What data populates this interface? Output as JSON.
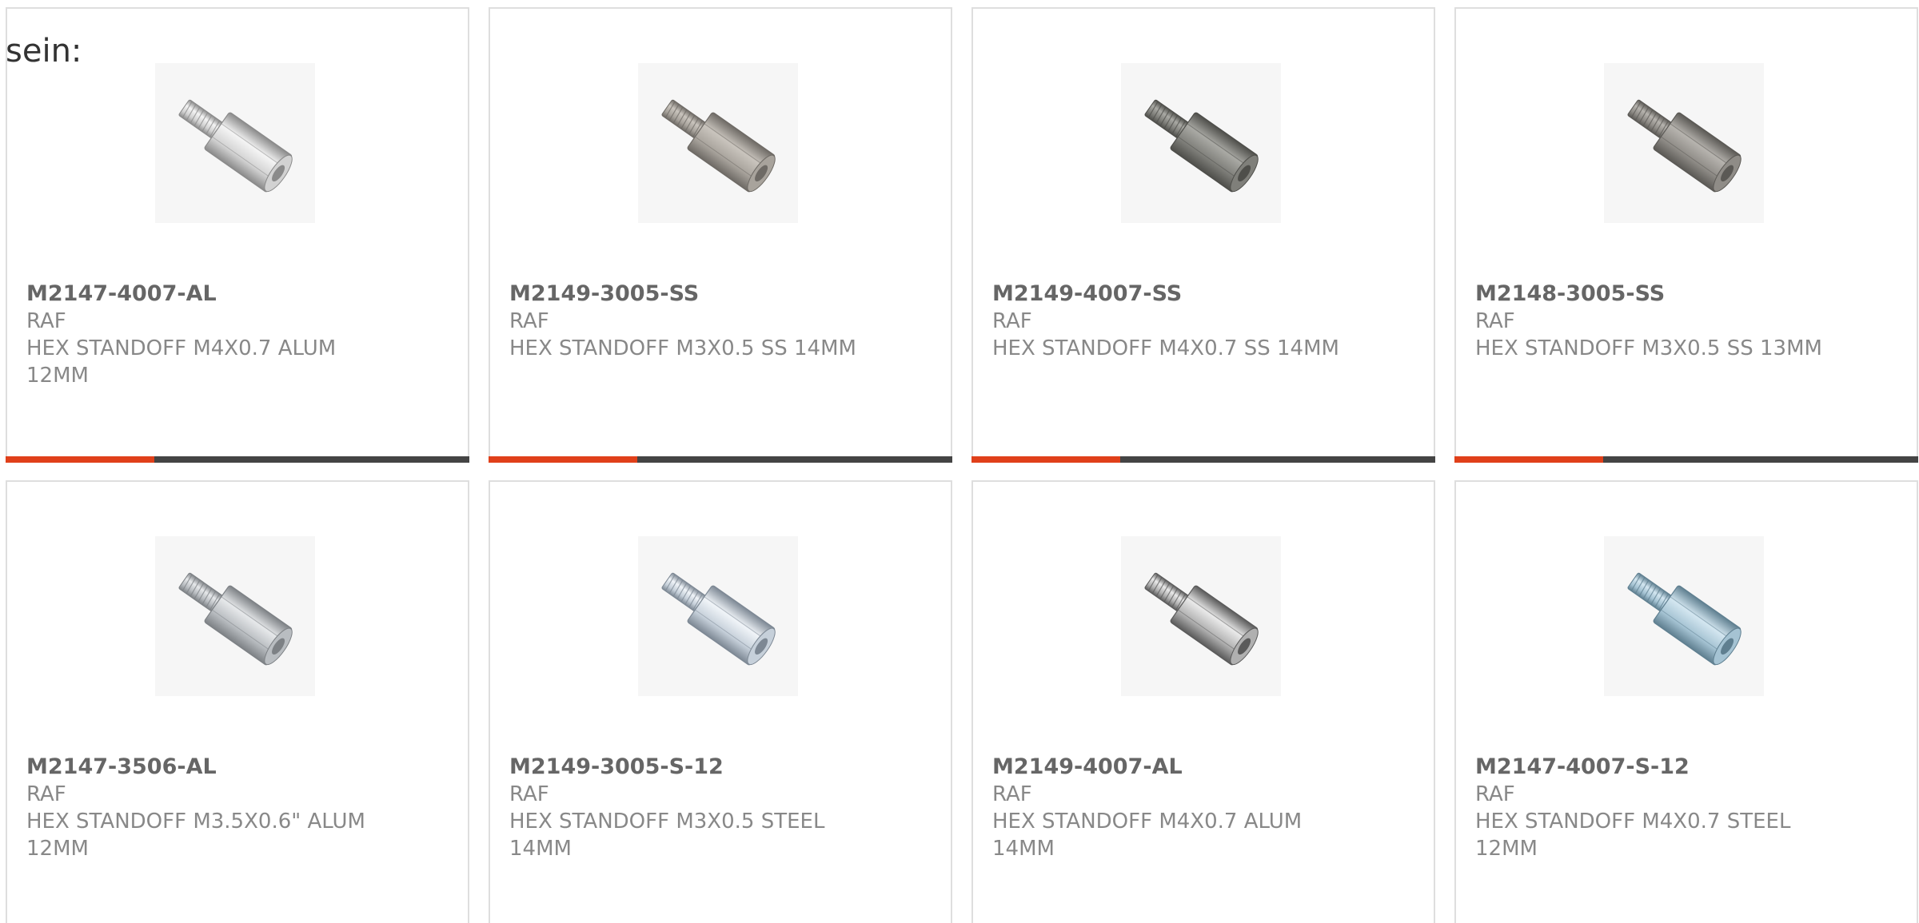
{
  "page": {
    "lead_text": "sein:",
    "accent_color": "#e0401a",
    "track_color": "#444444"
  },
  "products": [
    {
      "part_no": "M2147-4007-AL",
      "brand": "RAF",
      "desc_line1": "HEX STANDOFF M4X0.7 ALUM",
      "desc_line2": "12MM",
      "progress": 0.32,
      "image": "standoff-aluminum-icon",
      "tone": {
        "light": "#f4f4f4",
        "mid": "#d2d2d2",
        "dark": "#8a8a8a"
      }
    },
    {
      "part_no": "M2149-3005-SS",
      "brand": "RAF",
      "desc_line1": "HEX STANDOFF M3X0.5 SS 14MM",
      "desc_line2": "",
      "progress": 0.32,
      "image": "standoff-stainless-icon",
      "tone": {
        "light": "#c9c4bd",
        "mid": "#a8a39c",
        "dark": "#6e6a65"
      }
    },
    {
      "part_no": "M2149-4007-SS",
      "brand": "RAF",
      "desc_line1": "HEX STANDOFF M4X0.7 SS 14MM",
      "desc_line2": "",
      "progress": 0.32,
      "image": "standoff-stainless-icon",
      "tone": {
        "light": "#a9a9a4",
        "mid": "#7f7f7a",
        "dark": "#4e4e4a"
      }
    },
    {
      "part_no": "M2148-3005-SS",
      "brand": "RAF",
      "desc_line1": "HEX STANDOFF M3X0.5 SS 13MM",
      "desc_line2": "",
      "progress": 0.32,
      "image": "standoff-stainless-icon",
      "tone": {
        "light": "#b6b3ae",
        "mid": "#8f8c87",
        "dark": "#5b5955"
      }
    },
    {
      "part_no": "M2147-3506-AL",
      "brand": "RAF",
      "desc_line1": "HEX STANDOFF M3.5X0.6\" ALUM",
      "desc_line2": "12MM",
      "progress": null,
      "image": "standoff-aluminum-icon",
      "tone": {
        "light": "#e6e8ea",
        "mid": "#b9bdc1",
        "dark": "#7d8185"
      }
    },
    {
      "part_no": "M2149-3005-S-12",
      "brand": "RAF",
      "desc_line1": "HEX STANDOFF M3X0.5 STEEL",
      "desc_line2": "14MM",
      "progress": null,
      "image": "standoff-steel-icon",
      "tone": {
        "light": "#f0f4f8",
        "mid": "#c6d0da",
        "dark": "#7d8894"
      }
    },
    {
      "part_no": "M2149-4007-AL",
      "brand": "RAF",
      "desc_line1": "HEX STANDOFF M4X0.7 ALUM",
      "desc_line2": "14MM",
      "progress": null,
      "image": "standoff-aluminum-icon",
      "tone": {
        "light": "#e9e9e9",
        "mid": "#b0b0b0",
        "dark": "#5a5a5a"
      }
    },
    {
      "part_no": "M2147-4007-S-12",
      "brand": "RAF",
      "desc_line1": "HEX STANDOFF M4X0.7 STEEL",
      "desc_line2": "12MM",
      "progress": null,
      "image": "standoff-zinc-icon",
      "tone": {
        "light": "#d3e6f0",
        "mid": "#a5c3d3",
        "dark": "#5f7f90"
      }
    }
  ]
}
